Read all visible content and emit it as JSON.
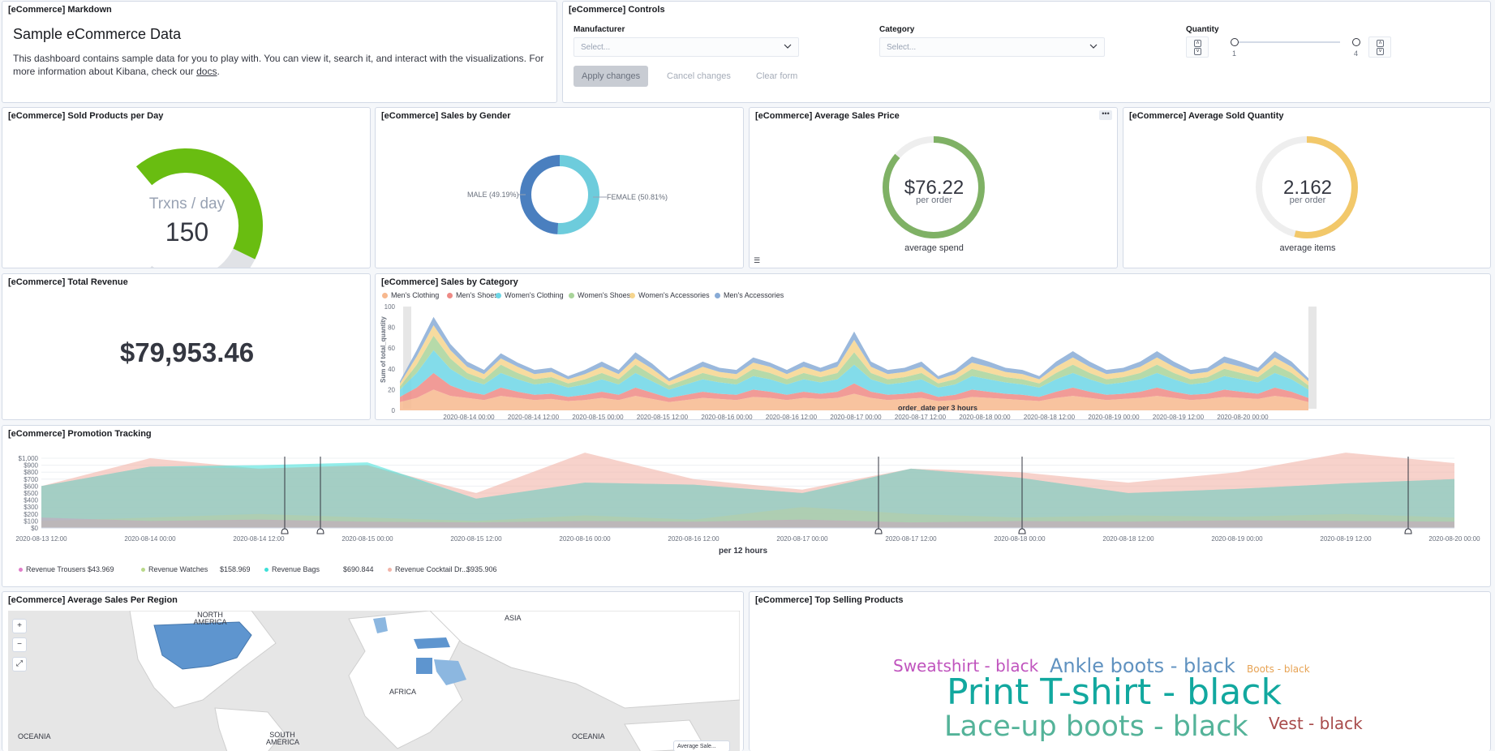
{
  "markdown": {
    "title": "[eCommerce] Markdown",
    "heading": "Sample eCommerce Data",
    "body_before": "This dashboard contains sample data for you to play with. You can view it, search it, and interact with the visualizations. For more information about Kibana, check our ",
    "link": "docs",
    "body_after": "."
  },
  "controls": {
    "title": "[eCommerce] Controls",
    "manufacturer_label": "Manufacturer",
    "manufacturer_placeholder": "Select...",
    "category_label": "Category",
    "category_placeholder": "Select...",
    "quantity_label": "Quantity",
    "quantity_min": "1",
    "quantity_max": "4",
    "apply": "Apply changes",
    "cancel": "Cancel changes",
    "clear": "Clear form"
  },
  "sold_per_day": {
    "title": "[eCommerce] Sold Products per Day",
    "label": "Trxns / day",
    "value": "150",
    "fraction": 0.6
  },
  "gender": {
    "title": "[eCommerce] Sales by Gender",
    "male": "MALE (49.19%)",
    "female": "FEMALE (50.81%)",
    "male_pct": 49.19,
    "female_pct": 50.81
  },
  "avg_price": {
    "title": "[eCommerce] Average Sales Price",
    "value": "$76.22",
    "sub": "per order",
    "caption": "average spend"
  },
  "avg_qty": {
    "title": "[eCommerce] Average Sold Quantity",
    "value": "2.162",
    "sub": "per order",
    "caption": "average items"
  },
  "revenue": {
    "title": "[eCommerce] Total Revenue",
    "value": "$79,953.46"
  },
  "category": {
    "title": "[eCommerce] Sales by Category",
    "ylabel": "Sum of total_quantity",
    "xlabel": "order_date per 3 hours",
    "legend": [
      {
        "name": "Men's Clothing",
        "color": "#f7b88e"
      },
      {
        "name": "Men's Shoes",
        "color": "#ee8a85"
      },
      {
        "name": "Women's Clothing",
        "color": "#6dd6e6"
      },
      {
        "name": "Women's Shoes",
        "color": "#a9d49a"
      },
      {
        "name": "Women's Accessories",
        "color": "#f6d58e"
      },
      {
        "name": "Men's Accessories",
        "color": "#88abd6"
      }
    ],
    "yticks": [
      "0",
      "20",
      "40",
      "60",
      "80",
      "100"
    ],
    "xticks": [
      "2020-08-14 00:00",
      "2020-08-14 12:00",
      "2020-08-15 00:00",
      "2020-08-15 12:00",
      "2020-08-16 00:00",
      "2020-08-16 12:00",
      "2020-08-17 00:00",
      "2020-08-17 12:00",
      "2020-08-18 00:00",
      "2020-08-18 12:00",
      "2020-08-19 00:00",
      "2020-08-19 12:00",
      "2020-08-20 00:00"
    ]
  },
  "promo": {
    "title": "[eCommerce] Promotion Tracking",
    "xlabel": "per 12 hours",
    "yticks": [
      "$0",
      "$100",
      "$200",
      "$300",
      "$400",
      "$500",
      "$600",
      "$700",
      "$800",
      "$900",
      "$1,000"
    ],
    "xticks": [
      "2020-08-13 12:00",
      "2020-08-14 00:00",
      "2020-08-14 12:00",
      "2020-08-15 00:00",
      "2020-08-15 12:00",
      "2020-08-16 00:00",
      "2020-08-16 12:00",
      "2020-08-17 00:00",
      "2020-08-17 12:00",
      "2020-08-18 00:00",
      "2020-08-18 12:00",
      "2020-08-19 00:00",
      "2020-08-19 12:00",
      "2020-08-20 00:00"
    ],
    "legend": [
      {
        "name": "Revenue Trousers",
        "value": "$43.969",
        "color": "#e07dc9"
      },
      {
        "name": "Revenue Watches",
        "value": "$158.969",
        "color": "#b9d98a"
      },
      {
        "name": "Revenue Bags",
        "value": "$690.844",
        "color": "#3de0d8"
      },
      {
        "name": "Revenue Cocktail Dr...",
        "value": "$935.906",
        "color": "#f2b4a8"
      }
    ]
  },
  "chart_data": [
    {
      "type": "area",
      "title": "[eCommerce] Sales by Category",
      "xlabel": "order_date per 3 hours",
      "ylabel": "Sum of total_quantity",
      "ylim": [
        0,
        100
      ],
      "x_range": [
        "2020-08-13 15:00",
        "2020-08-20 09:00"
      ],
      "stacked": true,
      "x_points": 55,
      "series": [
        {
          "name": "Men's Clothing",
          "values": [
            8,
            12,
            20,
            14,
            12,
            10,
            14,
            12,
            10,
            11,
            9,
            10,
            12,
            10,
            14,
            11,
            8,
            10,
            12,
            11,
            10,
            13,
            12,
            10,
            12,
            11,
            12,
            16,
            12,
            10,
            11,
            12,
            9,
            10,
            13,
            12,
            11,
            10,
            9,
            12,
            14,
            12,
            10,
            11,
            12,
            14,
            12,
            10,
            11,
            13,
            12,
            11,
            14,
            12,
            8
          ]
        },
        {
          "name": "Men's Shoes",
          "values": [
            5,
            10,
            16,
            10,
            6,
            5,
            8,
            6,
            5,
            5,
            4,
            5,
            6,
            5,
            8,
            6,
            4,
            5,
            6,
            5,
            5,
            7,
            6,
            5,
            6,
            5,
            6,
            10,
            6,
            5,
            5,
            6,
            4,
            5,
            7,
            6,
            5,
            5,
            4,
            6,
            8,
            6,
            5,
            5,
            6,
            8,
            6,
            5,
            5,
            7,
            6,
            5,
            8,
            6,
            4
          ]
        },
        {
          "name": "Women's Clothing",
          "values": [
            7,
            14,
            22,
            16,
            12,
            10,
            14,
            12,
            10,
            11,
            9,
            10,
            12,
            10,
            14,
            11,
            8,
            10,
            12,
            11,
            10,
            13,
            12,
            10,
            12,
            11,
            12,
            18,
            12,
            10,
            11,
            12,
            9,
            10,
            13,
            12,
            11,
            10,
            9,
            12,
            14,
            12,
            10,
            11,
            12,
            14,
            12,
            10,
            11,
            13,
            12,
            11,
            14,
            12,
            8
          ]
        },
        {
          "name": "Women's Shoes",
          "values": [
            3,
            8,
            14,
            10,
            6,
            5,
            8,
            6,
            5,
            5,
            4,
            5,
            6,
            5,
            8,
            6,
            4,
            5,
            6,
            5,
            5,
            7,
            6,
            5,
            6,
            5,
            6,
            12,
            6,
            5,
            5,
            6,
            4,
            5,
            7,
            6,
            5,
            5,
            4,
            6,
            8,
            6,
            5,
            5,
            6,
            8,
            6,
            5,
            5,
            7,
            6,
            5,
            8,
            6,
            4
          ]
        },
        {
          "name": "Women's Accessories",
          "values": [
            3,
            8,
            10,
            8,
            6,
            5,
            6,
            6,
            5,
            5,
            4,
            5,
            6,
            5,
            6,
            6,
            4,
            5,
            6,
            5,
            5,
            6,
            6,
            5,
            6,
            5,
            6,
            12,
            6,
            5,
            5,
            6,
            4,
            5,
            6,
            6,
            5,
            5,
            4,
            6,
            7,
            6,
            5,
            5,
            6,
            7,
            6,
            5,
            5,
            6,
            6,
            5,
            7,
            6,
            4
          ]
        },
        {
          "name": "Men's Accessories",
          "values": [
            2,
            6,
            8,
            6,
            5,
            4,
            5,
            4,
            4,
            4,
            3,
            4,
            5,
            4,
            6,
            5,
            3,
            4,
            5,
            4,
            4,
            5,
            4,
            4,
            5,
            4,
            5,
            8,
            5,
            4,
            4,
            5,
            3,
            4,
            6,
            5,
            4,
            4,
            3,
            5,
            6,
            5,
            4,
            4,
            5,
            6,
            5,
            4,
            4,
            6,
            5,
            4,
            6,
            5,
            3
          ]
        }
      ]
    },
    {
      "type": "area",
      "title": "[eCommerce] Promotion Tracking",
      "xlabel": "per 12 hours",
      "ylim": [
        0,
        1000
      ],
      "x": [
        "2020-08-13 12:00",
        "2020-08-14 00:00",
        "2020-08-14 12:00",
        "2020-08-15 00:00",
        "2020-08-15 12:00",
        "2020-08-16 00:00",
        "2020-08-16 12:00",
        "2020-08-17 00:00",
        "2020-08-17 12:00",
        "2020-08-18 00:00",
        "2020-08-18 12:00",
        "2020-08-19 00:00",
        "2020-08-19 12:00",
        "2020-08-20 00:00"
      ],
      "series": [
        {
          "name": "Revenue Trousers",
          "values": [
            150,
            100,
            120,
            90,
            80,
            100,
            90,
            120,
            80,
            100,
            90,
            110,
            100,
            90
          ]
        },
        {
          "name": "Revenue Watches",
          "values": [
            100,
            150,
            200,
            150,
            100,
            180,
            120,
            300,
            200,
            150,
            180,
            160,
            200,
            150
          ]
        },
        {
          "name": "Revenue Bags",
          "values": [
            600,
            880,
            900,
            940,
            420,
            650,
            620,
            500,
            850,
            720,
            500,
            560,
            640,
            700
          ]
        },
        {
          "name": "Revenue Cocktail Dr...",
          "values": [
            600,
            1000,
            850,
            900,
            500,
            1080,
            700,
            550,
            850,
            800,
            650,
            800,
            1080,
            930
          ]
        }
      ]
    },
    {
      "type": "pie",
      "title": "[eCommerce] Sales by Gender",
      "categories": [
        "MALE",
        "FEMALE"
      ],
      "values": [
        49.19,
        50.81
      ]
    }
  ],
  "region": {
    "title": "[eCommerce] Average Sales Per Region",
    "labels": [
      "NORTH AMERICA",
      "ASIA",
      "AFRICA",
      "SOUTH AMERICA",
      "OCEANIA",
      "OCEANIA"
    ],
    "legend": "Average Sale..."
  },
  "top_products": {
    "title": "[eCommerce] Top Selling Products",
    "words": [
      {
        "text": "Sweatshirt - black",
        "color": "#c054be"
      },
      {
        "text": "Ankle boots - black",
        "color": "#6092c0"
      },
      {
        "text": "Boots - black",
        "color": "#e7a354"
      },
      {
        "text": "Print T-shirt - black",
        "color": "#12a89f"
      },
      {
        "text": "Lace-up boots - black",
        "color": "#54b399"
      },
      {
        "text": "Vest - black",
        "color": "#a84b4b"
      }
    ]
  }
}
